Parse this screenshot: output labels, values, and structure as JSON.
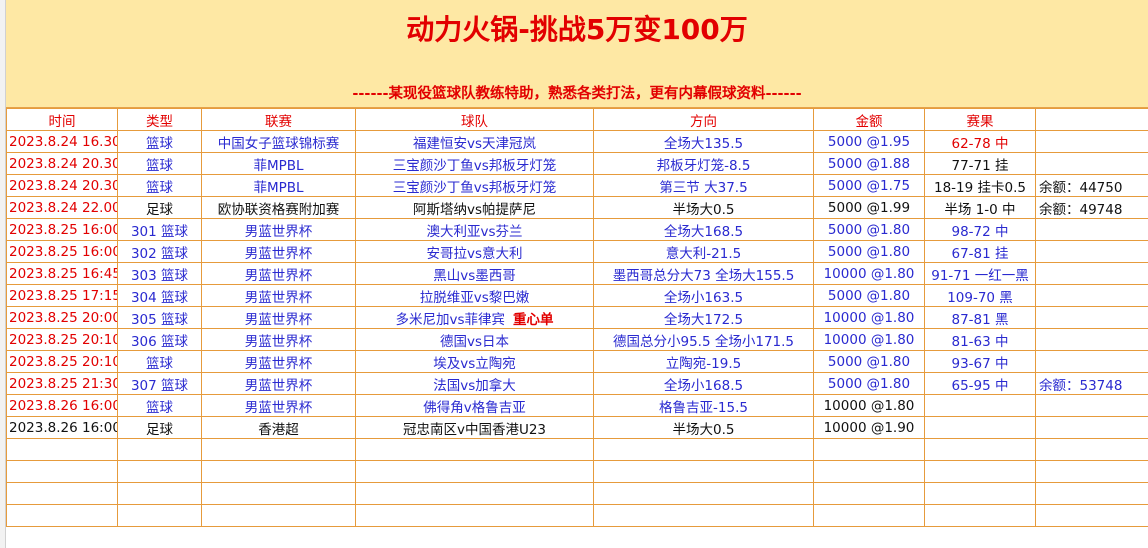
{
  "banner": {
    "title": "动力火锅-挑战5万变100万",
    "subtitle": "------某现役篮球队教练特助，熟悉各类打法，更有内幕假球资料------"
  },
  "headers": [
    "时间",
    "类型",
    "联赛",
    "球队",
    "方向",
    "金额",
    "赛果",
    ""
  ],
  "rows": [
    {
      "time": "2023.8.24 16.30",
      "type": "篮球",
      "league": "中国女子篮球锦标赛",
      "teams": "福建恒安vs天津冠岚",
      "teams_note": "",
      "pick": "全场大135.5",
      "stake": "5000 @1.95",
      "result": "62-78  中",
      "extra": "",
      "time_color": "red",
      "type_color": "blue",
      "league_color": "blue",
      "teams_color": "blue",
      "pick_color": "blue",
      "stake_color": "blue",
      "result_color": "red",
      "extra_color": "black"
    },
    {
      "time": "2023.8.24 20.30",
      "type": "篮球",
      "league": "菲MPBL",
      "teams": "三宝颜沙丁鱼vs邦板牙灯笼",
      "teams_note": "",
      "pick": "邦板牙灯笼-8.5",
      "stake": "5000 @1.88",
      "result": "77-71 挂",
      "extra": "",
      "time_color": "red",
      "type_color": "blue",
      "league_color": "blue",
      "teams_color": "blue",
      "pick_color": "blue",
      "stake_color": "blue",
      "result_color": "black",
      "extra_color": "black"
    },
    {
      "time": "2023.8.24 20.30",
      "type": "篮球",
      "league": "菲MPBL",
      "teams": "三宝颜沙丁鱼vs邦板牙灯笼",
      "teams_note": "",
      "pick": "第三节 大37.5",
      "stake": "5000 @1.75",
      "result": "18-19 挂卡0.5",
      "extra": "余额：44750",
      "time_color": "red",
      "type_color": "blue",
      "league_color": "blue",
      "teams_color": "blue",
      "pick_color": "blue",
      "stake_color": "blue",
      "result_color": "black",
      "extra_color": "black"
    },
    {
      "time": "2023.8.24 22.00",
      "type": "足球",
      "league": "欧协联资格赛附加赛",
      "teams": "阿斯塔纳vs帕提萨尼",
      "teams_note": "",
      "pick": "半场大0.5",
      "stake": "5000 @1.99",
      "result": "半场 1-0 中",
      "extra": "余额：49748",
      "time_color": "red",
      "type_color": "black",
      "league_color": "black",
      "teams_color": "black",
      "pick_color": "black",
      "stake_color": "black",
      "result_color": "black",
      "extra_color": "black"
    },
    {
      "time": "2023.8.25 16:00",
      "type": "301 篮球",
      "league": "男蓝世界杯",
      "teams": "澳大利亚vs芬兰",
      "teams_note": "",
      "pick": "全场大168.5",
      "stake": "5000 @1.80",
      "result": "98-72 中",
      "extra": "",
      "time_color": "red",
      "type_color": "blue",
      "league_color": "blue",
      "teams_color": "blue",
      "pick_color": "blue",
      "stake_color": "blue",
      "result_color": "blue",
      "extra_color": "black"
    },
    {
      "time": "2023.8.25 16:00",
      "type": "302 篮球",
      "league": "男蓝世界杯",
      "teams": "安哥拉vs意大利",
      "teams_note": "",
      "pick": "意大利-21.5",
      "stake": "5000 @1.80",
      "result": "67-81 挂",
      "extra": "",
      "time_color": "red",
      "type_color": "blue",
      "league_color": "blue",
      "teams_color": "blue",
      "pick_color": "blue",
      "stake_color": "blue",
      "result_color": "blue",
      "extra_color": "black"
    },
    {
      "time": "2023.8.25 16:45",
      "type": "303 篮球",
      "league": "男蓝世界杯",
      "teams": "黑山vs墨西哥",
      "teams_note": "",
      "pick": "墨西哥总分大73  全场大155.5",
      "stake": "10000 @1.80",
      "result": "91-71 一红一黑",
      "extra": "",
      "time_color": "red",
      "type_color": "blue",
      "league_color": "blue",
      "teams_color": "blue",
      "pick_color": "blue",
      "stake_color": "blue",
      "result_color": "blue",
      "extra_color": "black"
    },
    {
      "time": "2023.8.25 17:15",
      "type": "304 篮球",
      "league": "男蓝世界杯",
      "teams": "拉脱维亚vs黎巴嫩",
      "teams_note": "",
      "pick": "全场小163.5",
      "stake": "5000 @1.80",
      "result": "109-70 黑",
      "extra": "",
      "time_color": "red",
      "type_color": "blue",
      "league_color": "blue",
      "teams_color": "blue",
      "pick_color": "blue",
      "stake_color": "blue",
      "result_color": "blue",
      "extra_color": "black"
    },
    {
      "time": "2023.8.25 20:00",
      "type": "305 篮球",
      "league": "男蓝世界杯",
      "teams": "多米尼加vs菲律宾",
      "teams_note": "重心单",
      "pick": "全场大172.5",
      "stake": "10000 @1.80",
      "result": "87-81 黑",
      "extra": "",
      "time_color": "red",
      "type_color": "blue",
      "league_color": "blue",
      "teams_color": "blue",
      "pick_color": "blue",
      "stake_color": "blue",
      "result_color": "blue",
      "extra_color": "black"
    },
    {
      "time": "2023.8.25 20:10",
      "type": "306 篮球",
      "league": "男蓝世界杯",
      "teams": "德国vs日本",
      "teams_note": "",
      "pick": "德国总分小95.5  全场小171.5",
      "stake": "10000 @1.80",
      "result": "81-63 中",
      "extra": "",
      "time_color": "red",
      "type_color": "blue",
      "league_color": "blue",
      "teams_color": "blue",
      "pick_color": "blue",
      "stake_color": "blue",
      "result_color": "blue",
      "extra_color": "black"
    },
    {
      "time": "2023.8.25 20:10",
      "type": "篮球",
      "league": "男蓝世界杯",
      "teams": "埃及vs立陶宛",
      "teams_note": "",
      "pick": "立陶宛-19.5",
      "stake": "5000 @1.80",
      "result": "93-67 中",
      "extra": "",
      "time_color": "red",
      "type_color": "blue",
      "league_color": "blue",
      "teams_color": "blue",
      "pick_color": "blue",
      "stake_color": "blue",
      "result_color": "blue",
      "extra_color": "black"
    },
    {
      "time": "2023.8.25 21:30",
      "type": "307 篮球",
      "league": "男蓝世界杯",
      "teams": "法国vs加拿大",
      "teams_note": "",
      "pick": "全场小168.5",
      "stake": "5000 @1.80",
      "result": "65-95 中",
      "extra": "余额：53748",
      "time_color": "red",
      "type_color": "blue",
      "league_color": "blue",
      "teams_color": "blue",
      "pick_color": "blue",
      "stake_color": "blue",
      "result_color": "blue",
      "extra_color": "blue"
    },
    {
      "time": "2023.8.26 16:00",
      "type": "篮球",
      "league": "男蓝世界杯",
      "teams": "佛得角v格鲁吉亚",
      "teams_note": "",
      "pick": "格鲁吉亚-15.5",
      "stake": "10000 @1.80",
      "result": "",
      "extra": "",
      "time_color": "red",
      "type_color": "blue",
      "league_color": "blue",
      "teams_color": "blue",
      "pick_color": "blue",
      "stake_color": "black",
      "result_color": "black",
      "extra_color": "black"
    },
    {
      "time": "2023.8.26 16:00",
      "type": "足球",
      "league": "香港超",
      "teams": "冠忠南区v中国香港U23",
      "teams_note": "",
      "pick": "半场大0.5",
      "stake": "10000 @1.90",
      "result": "",
      "extra": "",
      "time_color": "black",
      "type_color": "black",
      "league_color": "black",
      "teams_color": "black",
      "pick_color": "black",
      "stake_color": "black",
      "result_color": "black",
      "extra_color": "black"
    }
  ],
  "blank_rows": 4
}
